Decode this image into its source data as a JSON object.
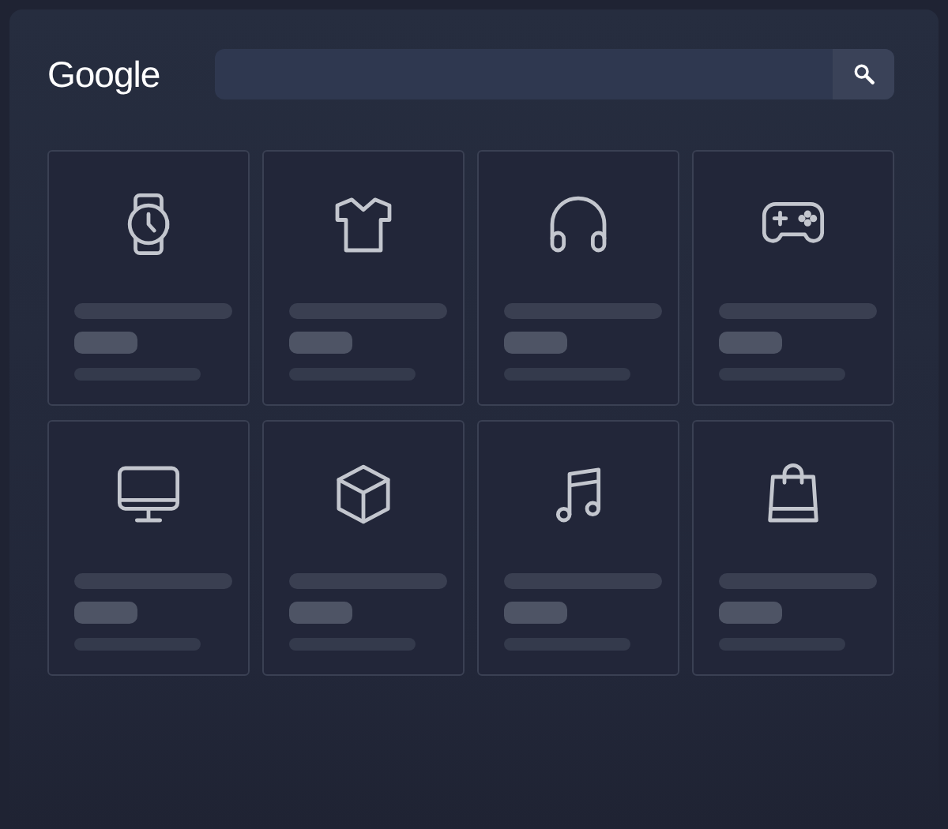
{
  "header": {
    "logo": "Google"
  },
  "products": [
    {
      "kind": "watch"
    },
    {
      "kind": "shirt"
    },
    {
      "kind": "headphones"
    },
    {
      "kind": "gamepad"
    },
    {
      "kind": "monitor"
    },
    {
      "kind": "cube"
    },
    {
      "kind": "music"
    },
    {
      "kind": "bag"
    }
  ]
}
